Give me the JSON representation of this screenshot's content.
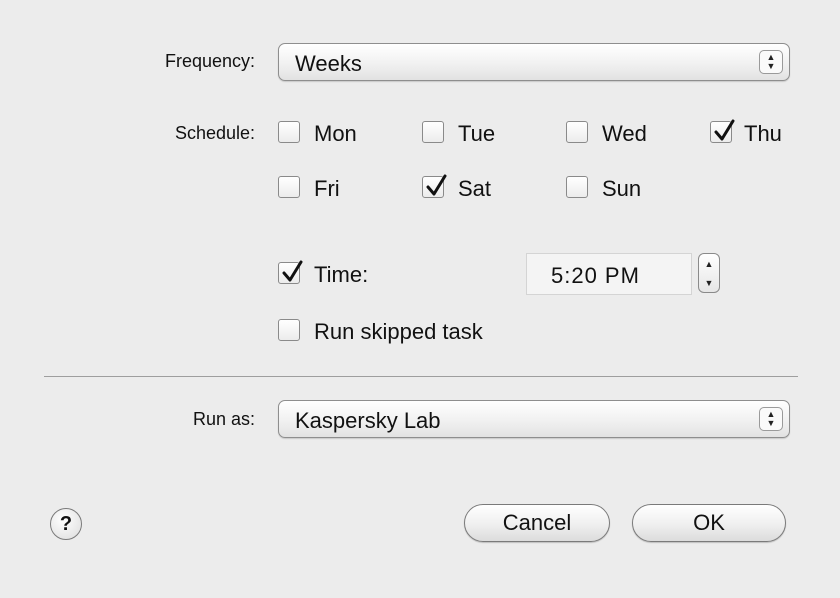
{
  "frequency": {
    "label": "Frequency:",
    "value": "Weeks"
  },
  "schedule": {
    "label": "Schedule:",
    "days": [
      {
        "name": "Mon",
        "checked": false
      },
      {
        "name": "Tue",
        "checked": false
      },
      {
        "name": "Wed",
        "checked": false
      },
      {
        "name": "Thu",
        "checked": true
      },
      {
        "name": "Fri",
        "checked": false
      },
      {
        "name": "Sat",
        "checked": true
      },
      {
        "name": "Sun",
        "checked": false
      }
    ]
  },
  "time": {
    "label": "Time:",
    "checked": true,
    "value": "5:20 PM"
  },
  "run_skipped": {
    "label": "Run skipped task",
    "checked": false
  },
  "run_as": {
    "label": "Run as:",
    "value": "Kaspersky Lab"
  },
  "buttons": {
    "help": "?",
    "cancel": "Cancel",
    "ok": "OK"
  },
  "icons": {
    "popup_arrows": "up-down-chevron-icon",
    "stepper": "up-down-stepper-icon",
    "check": "checkmark-icon",
    "help": "question-mark-icon"
  }
}
